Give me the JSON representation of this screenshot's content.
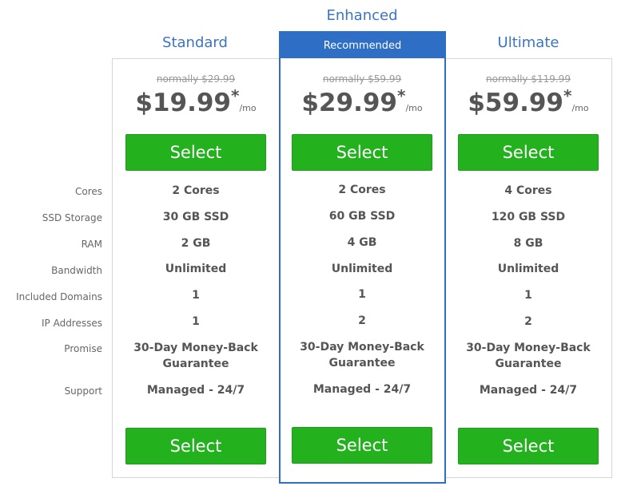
{
  "row_labels": [
    "Cores",
    "SSD Storage",
    "RAM",
    "Bandwidth",
    "Included Domains",
    "IP Addresses",
    "Promise",
    "Support"
  ],
  "plans": [
    {
      "name": "Standard",
      "normally": "normally $29.99",
      "price": "$19.99",
      "asterisk": "*",
      "per": "/mo",
      "select_top": "Select",
      "select_bottom": "Select",
      "features": [
        "2 Cores",
        "30 GB SSD",
        "2 GB",
        "Unlimited",
        "1",
        "1",
        "30-Day Money-Back Guarantee",
        "Managed - 24/7"
      ]
    },
    {
      "name": "Enhanced",
      "badge": "Recommended",
      "normally": "normally $59.99",
      "price": "$29.99",
      "asterisk": "*",
      "per": "/mo",
      "select_top": "Select",
      "select_bottom": "Select",
      "features": [
        "2 Cores",
        "60 GB SSD",
        "4 GB",
        "Unlimited",
        "1",
        "2",
        "30-Day Money-Back Guarantee",
        "Managed - 24/7"
      ]
    },
    {
      "name": "Ultimate",
      "normally": "normally $119.99",
      "price": "$59.99",
      "asterisk": "*",
      "per": "/mo",
      "select_top": "Select",
      "select_bottom": "Select",
      "features": [
        "4 Cores",
        "120 GB SSD",
        "8 GB",
        "Unlimited",
        "1",
        "2",
        "30-Day Money-Back Guarantee",
        "Managed - 24/7"
      ]
    }
  ],
  "colors": {
    "accent_blue": "#2e6ec4",
    "title_blue": "#3b74c6",
    "select_green": "#23b11e"
  }
}
